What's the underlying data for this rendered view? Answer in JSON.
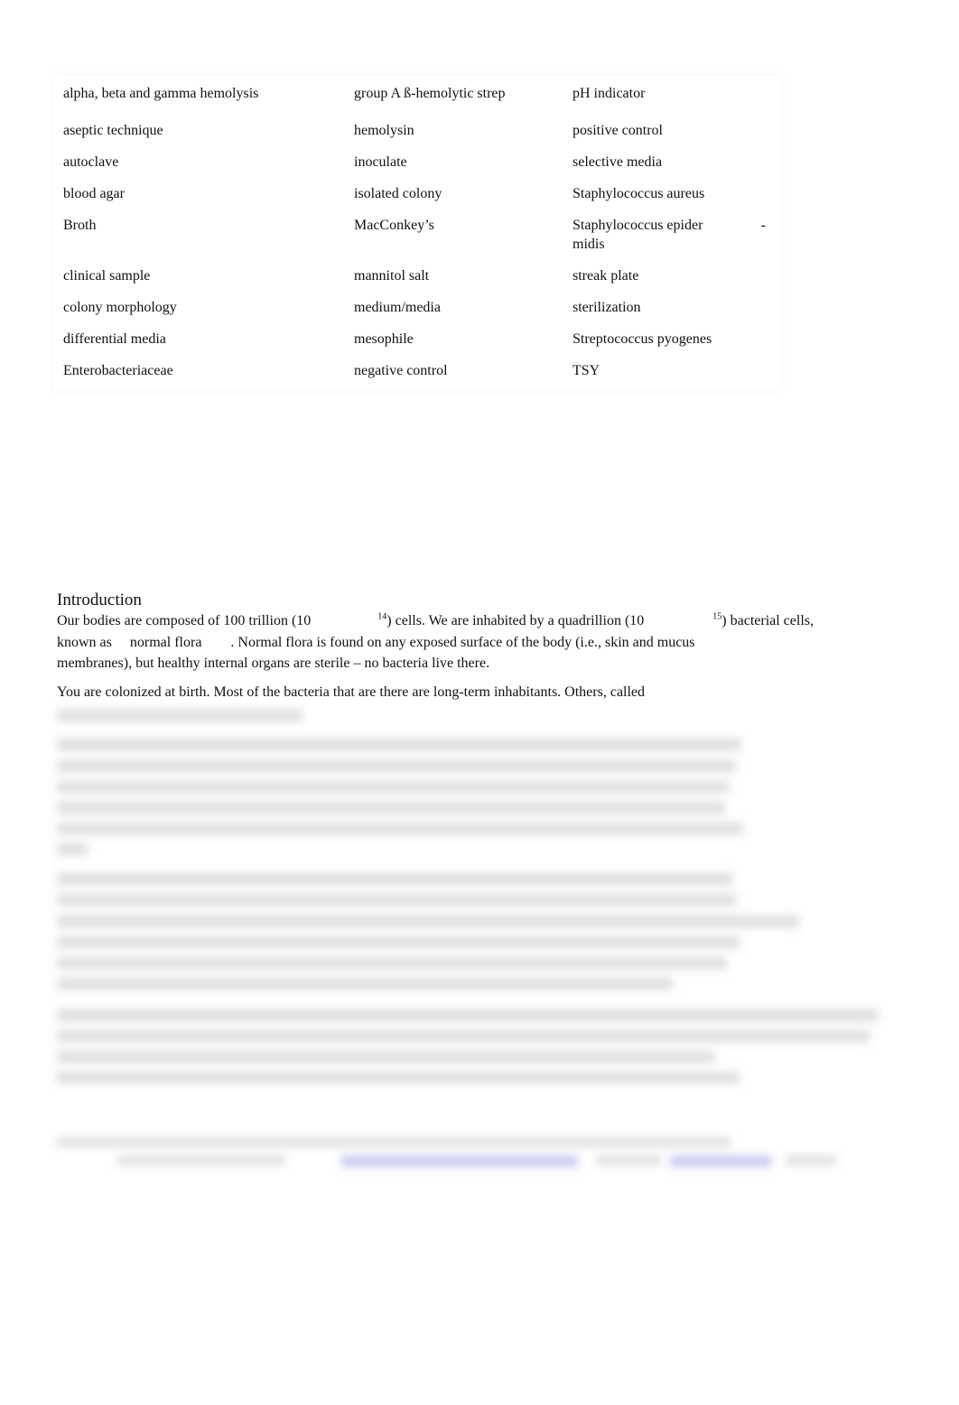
{
  "vocabulary_table": {
    "rows": [
      [
        "alpha, beta and gamma hemolysis",
        "group A ß-hemolytic strep",
        "pH indicator"
      ],
      [
        "aseptic technique",
        "hemolysin",
        "positive control"
      ],
      [
        "autoclave",
        "inoculate",
        "selective media"
      ],
      [
        "blood agar",
        "isolated colony",
        "Staphylococcus aureus"
      ],
      [
        "Broth",
        "MacConkey’s",
        "Staphylococcus epider"
      ],
      [
        "clinical sample",
        "mannitol salt",
        "streak plate"
      ],
      [
        "colony morphology",
        "medium/media",
        "sterilization"
      ],
      [
        "differential media",
        "mesophile",
        "Streptococcus pyogenes"
      ],
      [
        "Enterobacteriaceae",
        "negative control",
        "TSY"
      ]
    ],
    "row5_col3_hyphen": "-",
    "row5_col3_continuation": "midis"
  },
  "introduction": {
    "heading": "Introduction",
    "p1_a": "Our bodies are composed of 100 trillion (10",
    "p1_sup1": "14",
    "p1_b": ") cells. We are inhabited by a quadrillion (10",
    "p1_sup2": "15",
    "p1_c": ") bacterial cells,",
    "p1_d": "known as",
    "p1_term": "normal flora",
    "p1_e": ". Normal flora is found on any exposed surface of the body (i.e., skin and mucus",
    "p1_f": "membranes), but healthy internal organs are sterile – no bacteria live there.",
    "p2": "You are colonized at birth. Most of the bacteria that are there are long-term inhabitants. Others, called"
  }
}
